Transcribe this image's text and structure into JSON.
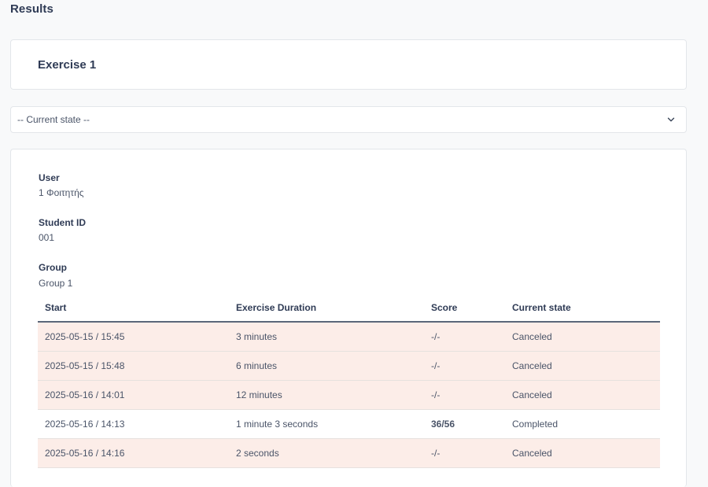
{
  "page": {
    "title": "Results"
  },
  "exercise": {
    "title": "Exercise 1"
  },
  "state_filter": {
    "selected": "-- Current state --",
    "icon": "chevron-down-icon"
  },
  "details": {
    "user_label": "User",
    "user_value": "1 Φοιτητής",
    "student_id_label": "Student ID",
    "student_id_value": "001",
    "group_label": "Group",
    "group_value": "Group 1"
  },
  "table": {
    "headers": {
      "start": "Start",
      "duration": "Exercise Duration",
      "score": "Score",
      "state": "Current state"
    },
    "rows": [
      {
        "start": "2025-05-15 / 15:45",
        "duration": "3 minutes",
        "score": "-/-",
        "state": "Canceled"
      },
      {
        "start": "2025-05-15 / 15:48",
        "duration": "6 minutes",
        "score": "-/-",
        "state": "Canceled"
      },
      {
        "start": "2025-05-16 / 14:01",
        "duration": "12 minutes",
        "score": "-/-",
        "state": "Canceled"
      },
      {
        "start": "2025-05-16 / 14:13",
        "duration": "1 minute 3 seconds",
        "score": "36/56",
        "state": "Completed"
      },
      {
        "start": "2025-05-16 / 14:16",
        "duration": "2 seconds",
        "score": "-/-",
        "state": "Canceled"
      }
    ]
  },
  "colors": {
    "canceled_row": "#fcede8",
    "completed_row": "#ffffff",
    "heading": "#2f3b55"
  }
}
